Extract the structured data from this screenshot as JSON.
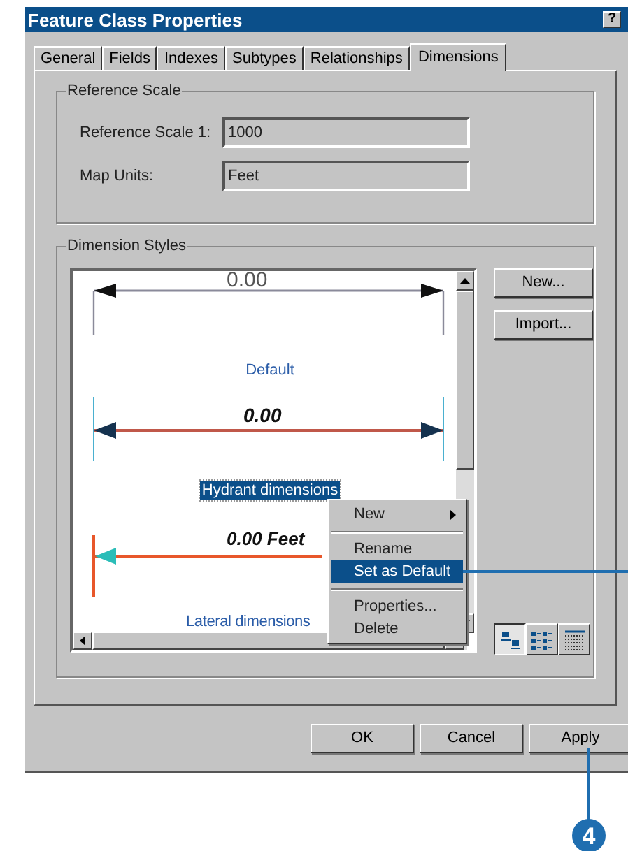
{
  "window": {
    "title": "Feature Class Properties",
    "help_button": "?"
  },
  "tabs": [
    {
      "label": "General",
      "selected": false
    },
    {
      "label": "Fields",
      "selected": false
    },
    {
      "label": "Indexes",
      "selected": false
    },
    {
      "label": "Subtypes",
      "selected": false
    },
    {
      "label": "Relationships",
      "selected": false
    },
    {
      "label": "Dimensions",
      "selected": true
    }
  ],
  "reference_scale": {
    "title": "Reference Scale",
    "fields": [
      {
        "label": "Reference Scale 1:",
        "value": "1000"
      },
      {
        "label": "Map Units:",
        "value": "Feet"
      }
    ]
  },
  "dimension_styles": {
    "title": "Dimension Styles",
    "styles": [
      {
        "kind": "plain",
        "sample": "0.00",
        "name": "Default",
        "selected": false
      },
      {
        "kind": "hydrant",
        "sample": "0.00",
        "name": "Hydrant dimensions",
        "selected": true
      },
      {
        "kind": "lateral",
        "sample": "0.00 Feet",
        "name": "Lateral dimensions",
        "selected": false
      }
    ],
    "buttons": [
      "New...",
      "Import..."
    ],
    "views": [
      {
        "kind": "large",
        "selected": true
      },
      {
        "kind": "list",
        "selected": false
      },
      {
        "kind": "details",
        "selected": false
      }
    ]
  },
  "context_menu": {
    "items": [
      {
        "label": "New",
        "submenu": true,
        "separator_before": false,
        "selected": false
      },
      {
        "label": "Rename",
        "submenu": false,
        "separator_before": true,
        "selected": false
      },
      {
        "label": "Set as Default",
        "submenu": false,
        "separator_before": false,
        "selected": true
      },
      {
        "label": "Properties...",
        "submenu": false,
        "separator_before": true,
        "selected": false
      },
      {
        "label": "Delete",
        "submenu": false,
        "separator_before": false,
        "selected": false
      }
    ]
  },
  "buttons": [
    "OK",
    "Cancel",
    "Apply"
  ],
  "callouts": [
    {
      "label": "4"
    }
  ]
}
